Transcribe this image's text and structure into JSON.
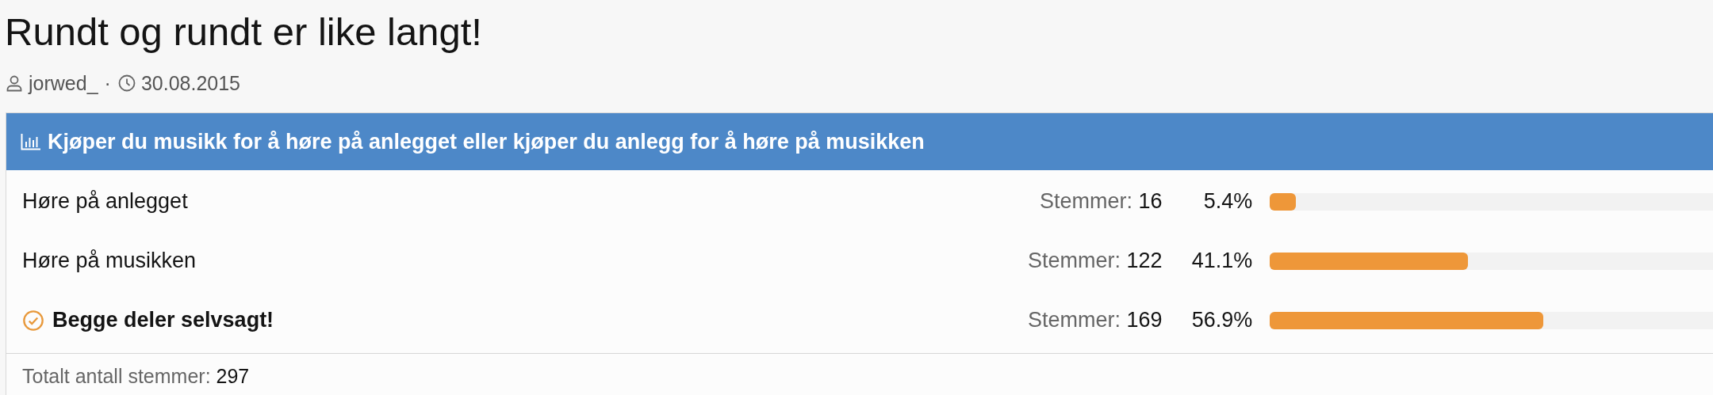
{
  "thread": {
    "title": "Rundt og rundt er like langt!",
    "author": "jorwed_",
    "separator": "·",
    "date": "30.08.2015"
  },
  "poll": {
    "question": "Kjøper du musikk for å høre på anlegget eller kjøper du anlegg for å høre på musikken",
    "options": [
      {
        "label": "Høre på anlegget",
        "votes_label": "Stemmer:",
        "votes": "16",
        "percent": "5.4%",
        "level": 0.054,
        "selected": false
      },
      {
        "label": "Høre på musikken",
        "votes_label": "Stemmer:",
        "votes": "122",
        "percent": "41.1%",
        "level": 0.411,
        "selected": false
      },
      {
        "label": "Begge deler selvsagt!",
        "votes_label": "Stemmer:",
        "votes": "169",
        "percent": "56.9%",
        "level": 0.569,
        "selected": true
      }
    ],
    "total_label": "Totalt antall stemmer:",
    "total": "297"
  }
}
